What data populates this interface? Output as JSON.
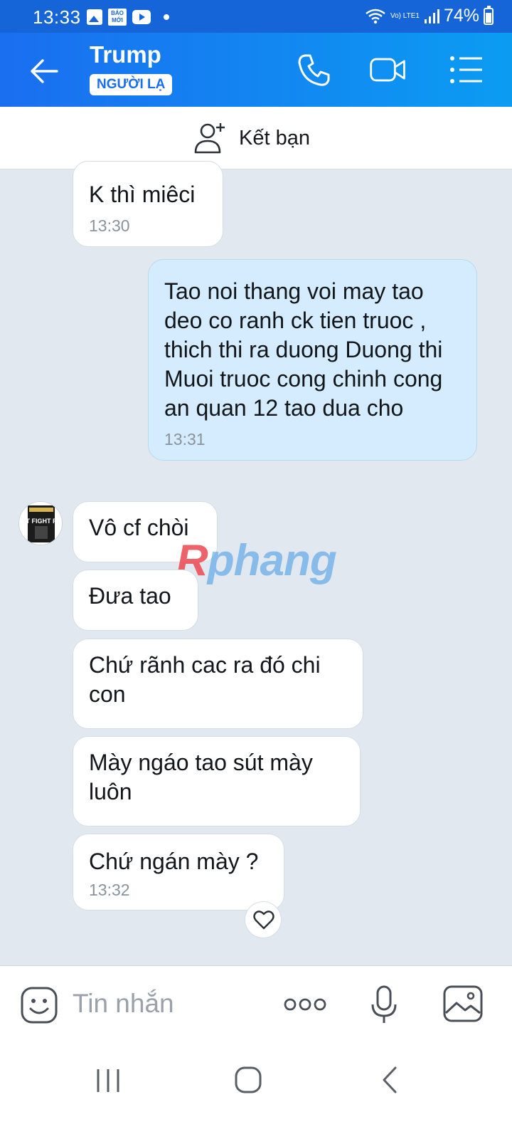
{
  "status_bar": {
    "time": "13:33",
    "baomoi": "BÁO MỚI",
    "lte": "Vo) LTE1",
    "battery": "74%"
  },
  "header": {
    "title": "Trump",
    "badge": "NGƯỜI LẠ",
    "icons": [
      "back-arrow-icon",
      "phone-icon",
      "video-call-icon",
      "menu-list-icon"
    ]
  },
  "add_friend": {
    "label": "Kết bạn",
    "icon": "add-friend-icon"
  },
  "messages": [
    {
      "side": "them",
      "text": "K thì miêci",
      "time": "13:30"
    },
    {
      "side": "me",
      "text": "Tao noi thang voi may tao deo co ranh ck tien truoc , thich thi ra duong Duong thi Muoi truoc cong chinh cong an quan 12 tao dua cho",
      "time": "13:31"
    },
    {
      "side": "them",
      "text": "Vô cf chòi"
    },
    {
      "side": "them",
      "text": "Đưa tao"
    },
    {
      "side": "them",
      "text": "Chứ rãnh cac ra đó chi con"
    },
    {
      "side": "them",
      "text": "Mày ngáo tao sút mày luôn"
    },
    {
      "side": "them",
      "text": "Chứ ngán mày ?",
      "time": "13:32"
    }
  ],
  "avatar_text": "FIGHT FIGHT FIGHT",
  "watermark": {
    "r": "R",
    "rest": "phang"
  },
  "composer": {
    "placeholder": "Tin nhắn",
    "icons": [
      "sticker-icon",
      "more-icon",
      "microphone-icon",
      "image-icon"
    ]
  },
  "nav": {
    "icons": [
      "recent-apps-icon",
      "home-icon",
      "back-icon"
    ]
  },
  "colors": {
    "header_start": "#1a6ef0",
    "header_end": "#0b9cf2",
    "my_bubble": "#d4ecfd",
    "background": "#e2e8ef"
  }
}
